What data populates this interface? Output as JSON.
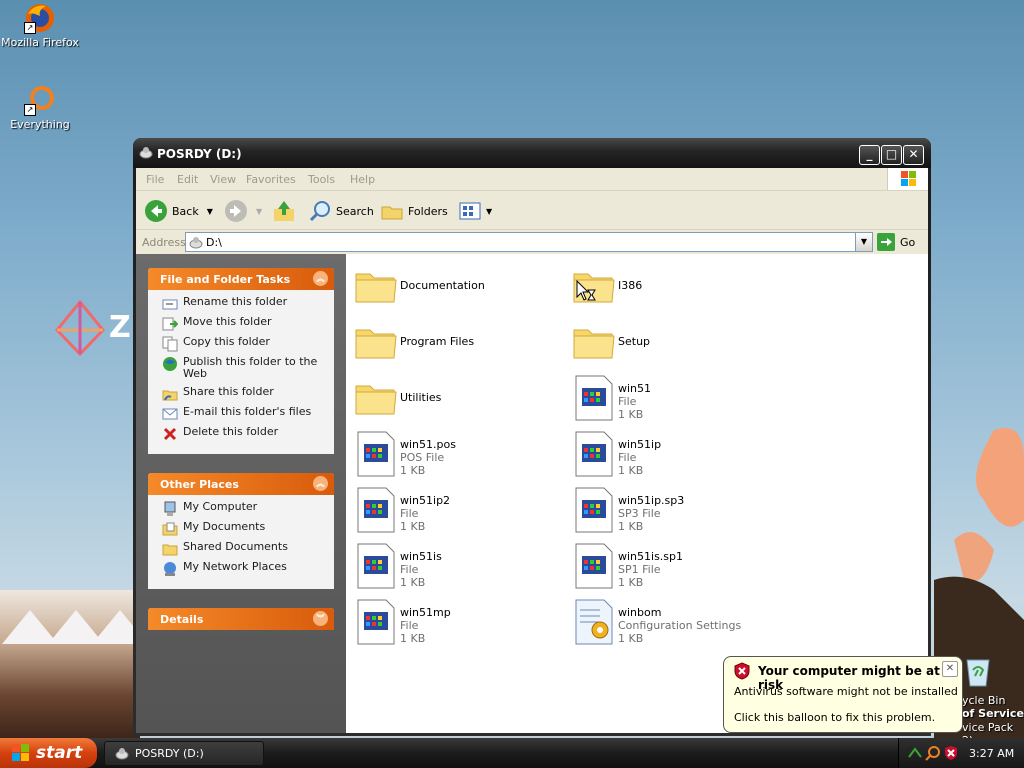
{
  "desktop": {
    "icons": [
      {
        "label": "Mozilla Firefox",
        "icon": "firefox-icon"
      },
      {
        "label": "Everything",
        "icon": "everything-search-icon"
      }
    ],
    "recycle_bin_label": "ycle Bin",
    "watermark_line1": "of Service",
    "watermark_line2": "vice Pack 2)",
    "logo_letter": "Z"
  },
  "window": {
    "title": "POSRDY (D:)",
    "controls": {
      "minimize": "_",
      "maximize": "□",
      "close": "✕"
    },
    "menu": [
      "File",
      "Edit",
      "View",
      "Favorites",
      "Tools",
      "Help"
    ],
    "toolbar": {
      "back": "Back",
      "search": "Search",
      "folders": "Folders"
    },
    "address": {
      "label": "Address",
      "value": "D:\\",
      "go": "Go"
    }
  },
  "tasks": {
    "file_folder": {
      "title": "File and Folder Tasks",
      "items": [
        {
          "label": "Rename this folder",
          "icon": "rename-icon"
        },
        {
          "label": "Move this folder",
          "icon": "move-icon"
        },
        {
          "label": "Copy this folder",
          "icon": "copy-icon"
        },
        {
          "label": "Publish this folder to the Web",
          "icon": "publish-web-icon"
        },
        {
          "label": "Share this folder",
          "icon": "share-icon"
        },
        {
          "label": "E-mail this folder's files",
          "icon": "email-icon"
        },
        {
          "label": "Delete this folder",
          "icon": "delete-icon"
        }
      ]
    },
    "other_places": {
      "title": "Other Places",
      "items": [
        {
          "label": "My Computer",
          "icon": "my-computer-icon"
        },
        {
          "label": "My Documents",
          "icon": "my-documents-icon"
        },
        {
          "label": "Shared Documents",
          "icon": "shared-documents-icon"
        },
        {
          "label": "My Network Places",
          "icon": "network-places-icon"
        }
      ]
    },
    "details": {
      "title": "Details"
    }
  },
  "files": [
    {
      "name": "Documentation",
      "kind": "folder"
    },
    {
      "name": "I386",
      "kind": "folder"
    },
    {
      "name": "Program Files",
      "kind": "folder"
    },
    {
      "name": "Setup",
      "kind": "folder"
    },
    {
      "name": "Utilities",
      "kind": "folder"
    },
    {
      "name": "win51",
      "type": "File",
      "size": "1 KB",
      "kind": "file"
    },
    {
      "name": "win51.pos",
      "type": "POS File",
      "size": "1 KB",
      "kind": "file"
    },
    {
      "name": "win51ip",
      "type": "File",
      "size": "1 KB",
      "kind": "file"
    },
    {
      "name": "win51ip2",
      "type": "File",
      "size": "1 KB",
      "kind": "file"
    },
    {
      "name": "win51ip.sp3",
      "type": "SP3 File",
      "size": "1 KB",
      "kind": "file"
    },
    {
      "name": "win51is",
      "type": "File",
      "size": "1 KB",
      "kind": "file"
    },
    {
      "name": "win51is.sp1",
      "type": "SP1 File",
      "size": "1 KB",
      "kind": "file"
    },
    {
      "name": "win51mp",
      "type": "File",
      "size": "1 KB",
      "kind": "file"
    },
    {
      "name": "winbom",
      "type": "Configuration Settings",
      "size": "1 KB",
      "kind": "config"
    }
  ],
  "balloon": {
    "title": "Your computer might be at risk",
    "line1": "Antivirus software might not be installed",
    "line2": "Click this balloon to fix this problem.",
    "close": "✕"
  },
  "taskbar": {
    "start": "start",
    "task_item": "POSRDY (D:)",
    "clock": "3:27 AM"
  },
  "colors": {
    "panel_header": "#e8701d",
    "titlebar": "#262626",
    "balloon_bg": "#ffffe1",
    "start_button": "#d6410e"
  }
}
